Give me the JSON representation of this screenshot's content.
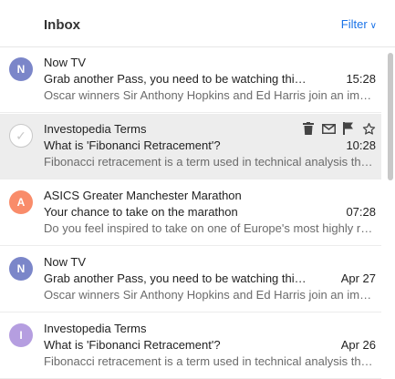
{
  "header": {
    "title": "Inbox",
    "filter_label": "Filter",
    "filter_icon": "chevron-down-icon"
  },
  "colors": {
    "accent": "#1a73e8",
    "avatar_n": "#7b86c9",
    "avatar_a": "#f98c6a",
    "avatar_i": "#b59ee0",
    "selected_row": "#ededed"
  },
  "messages": [
    {
      "avatar": "N",
      "sender": "Now TV",
      "subject": "Grab another Pass, you need to be watching this...",
      "time": "15:28",
      "preview": "Oscar winners Sir Anthony Hopkins and Ed Harris join an impressive cast"
    },
    {
      "avatar": "",
      "selected": true,
      "sender": "Investopedia Terms",
      "subject": "What is 'Fibonanci Retracement'?",
      "time": "10:28",
      "preview": "Fibonacci retracement is a term used in technical analysis that refers to",
      "actions": [
        "trash-icon",
        "mail-icon",
        "flag-icon",
        "star-icon"
      ]
    },
    {
      "avatar": "A",
      "sender": "ASICS Greater Manchester Marathon",
      "subject": "Your chance to take on the marathon",
      "time": "07:28",
      "preview": "Do you feel inspired to take on one of Europe's most highly regarded races"
    },
    {
      "avatar": "N",
      "sender": "Now TV",
      "subject": "Grab another Pass, you need to be watching this...",
      "time": "Apr 27",
      "preview": "Oscar winners Sir Anthony Hopkins and Ed Harris join an impressive cast"
    },
    {
      "avatar": "I",
      "sender": "Investopedia Terms",
      "subject": "What is 'Fibonanci Retracement'?",
      "time": "Apr 26",
      "preview": "Fibonacci retracement is a term used in technical analysis that refers to"
    }
  ]
}
